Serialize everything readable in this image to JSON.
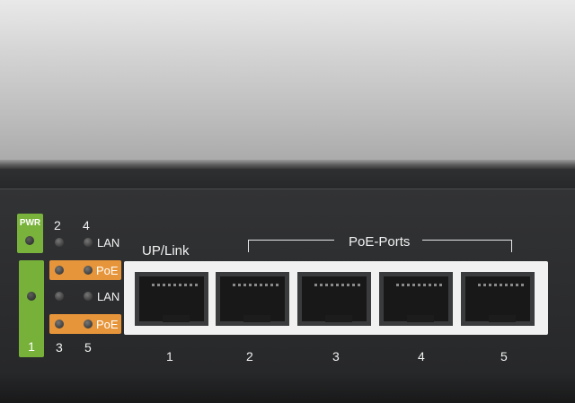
{
  "device": {
    "power_label": "PWR",
    "led_columns": [
      "2",
      "4"
    ],
    "led_columns_bottom": [
      "3",
      "5"
    ],
    "lan_label_top": "LAN",
    "lan_label_mid": "LAN",
    "poe_label_top": "PoE",
    "poe_label_bottom": "PoE",
    "uplink_label": "UP/Link",
    "poe_ports_label": "PoE-Ports",
    "uplink_number": "1",
    "port_numbers": [
      "1",
      "2",
      "3",
      "4",
      "5"
    ]
  },
  "colors": {
    "led_panel_green": "#7ab33b",
    "poe_orange": "#e7953a",
    "chassis_dark": "#2b2c2e",
    "top_cover": "#c9c9c9"
  }
}
